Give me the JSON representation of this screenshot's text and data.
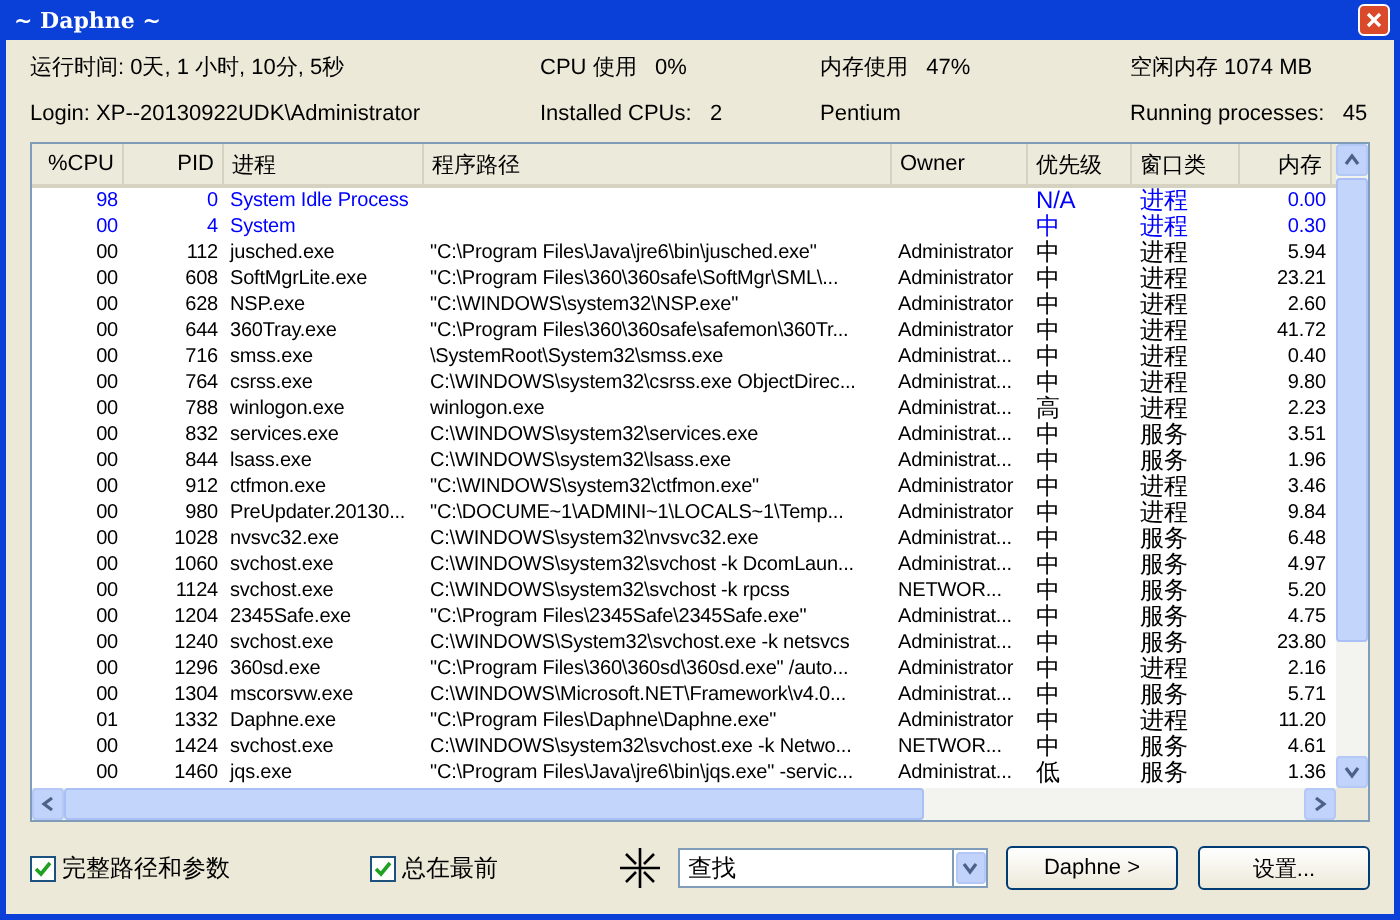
{
  "window": {
    "title": "~ Daphne ~"
  },
  "info": [
    {
      "label": "运行时间: 0天, 1 小时, 10分, 5秒"
    },
    {
      "label": "CPU 使用",
      "value": "0%"
    },
    {
      "label": "内存使用",
      "value": "47%"
    },
    {
      "label": "空闲内存 1074 MB"
    },
    {
      "label": "Login: XP--20130922UDK\\Administrator"
    },
    {
      "label": "Installed CPUs:",
      "value": "2"
    },
    {
      "label": "Pentium"
    },
    {
      "label": "Running processes:",
      "value": "45"
    }
  ],
  "table": {
    "columns": [
      "%CPU",
      "PID",
      "进程",
      "程序路径",
      "Owner",
      "优先级",
      "窗口类",
      "内存"
    ],
    "rows": [
      {
        "kind": "system",
        "cells": [
          "98",
          "0",
          "System Idle Process",
          "",
          "",
          "N/A",
          "进程",
          "0.00"
        ]
      },
      {
        "kind": "system",
        "cells": [
          "00",
          "4",
          "System",
          "",
          "",
          "中",
          "进程",
          "0.30"
        ]
      },
      {
        "kind": "normal",
        "cells": [
          "00",
          "112",
          "jusched.exe",
          "\"C:\\Program Files\\Java\\jre6\\bin\\jusched.exe\"",
          "Administrator",
          "中",
          "进程",
          "5.94"
        ]
      },
      {
        "kind": "normal",
        "cells": [
          "00",
          "608",
          "SoftMgrLite.exe",
          "\"C:\\Program Files\\360\\360safe\\SoftMgr\\SML\\...",
          "Administrator",
          "中",
          "进程",
          "23.21"
        ]
      },
      {
        "kind": "normal",
        "cells": [
          "00",
          "628",
          "NSP.exe",
          "\"C:\\WINDOWS\\system32\\NSP.exe\"",
          "Administrator",
          "中",
          "进程",
          "2.60"
        ]
      },
      {
        "kind": "normal",
        "cells": [
          "00",
          "644",
          "360Tray.exe",
          "\"C:\\Program Files\\360\\360safe\\safemon\\360Tr...",
          "Administrator",
          "中",
          "进程",
          "41.72"
        ]
      },
      {
        "kind": "normal",
        "cells": [
          "00",
          "716",
          "smss.exe",
          "\\SystemRoot\\System32\\smss.exe",
          "Administrat...",
          "中",
          "进程",
          "0.40"
        ]
      },
      {
        "kind": "normal",
        "cells": [
          "00",
          "764",
          "csrss.exe",
          "C:\\WINDOWS\\system32\\csrss.exe ObjectDirec...",
          "Administrat...",
          "中",
          "进程",
          "9.80"
        ]
      },
      {
        "kind": "normal",
        "cells": [
          "00",
          "788",
          "winlogon.exe",
          "winlogon.exe",
          "Administrat...",
          "高",
          "进程",
          "2.23"
        ]
      },
      {
        "kind": "normal",
        "cells": [
          "00",
          "832",
          "services.exe",
          "C:\\WINDOWS\\system32\\services.exe",
          "Administrat...",
          "中",
          "服务",
          "3.51"
        ]
      },
      {
        "kind": "normal",
        "cells": [
          "00",
          "844",
          "lsass.exe",
          "C:\\WINDOWS\\system32\\lsass.exe",
          "Administrat...",
          "中",
          "服务",
          "1.96"
        ]
      },
      {
        "kind": "normal",
        "cells": [
          "00",
          "912",
          "ctfmon.exe",
          "\"C:\\WINDOWS\\system32\\ctfmon.exe\"",
          "Administrator",
          "中",
          "进程",
          "3.46"
        ]
      },
      {
        "kind": "normal",
        "cells": [
          "00",
          "980",
          "PreUpdater.20130...",
          "\"C:\\DOCUME~1\\ADMINI~1\\LOCALS~1\\Temp...",
          "Administrator",
          "中",
          "进程",
          "9.84"
        ]
      },
      {
        "kind": "normal",
        "cells": [
          "00",
          "1028",
          "nvsvc32.exe",
          "C:\\WINDOWS\\system32\\nvsvc32.exe",
          "Administrat...",
          "中",
          "服务",
          "6.48"
        ]
      },
      {
        "kind": "normal",
        "cells": [
          "00",
          "1060",
          "svchost.exe",
          "C:\\WINDOWS\\system32\\svchost -k DcomLaun...",
          "Administrat...",
          "中",
          "服务",
          "4.97"
        ]
      },
      {
        "kind": "normal",
        "cells": [
          "00",
          "1124",
          "svchost.exe",
          "C:\\WINDOWS\\system32\\svchost -k rpcss",
          "NETWOR...",
          "中",
          "服务",
          "5.20"
        ]
      },
      {
        "kind": "normal",
        "cells": [
          "00",
          "1204",
          "2345Safe.exe",
          "\"C:\\Program Files\\2345Safe\\2345Safe.exe\"",
          "Administrat...",
          "中",
          "服务",
          "4.75"
        ]
      },
      {
        "kind": "normal",
        "cells": [
          "00",
          "1240",
          "svchost.exe",
          "C:\\WINDOWS\\System32\\svchost.exe -k netsvcs",
          "Administrat...",
          "中",
          "服务",
          "23.80"
        ]
      },
      {
        "kind": "normal",
        "cells": [
          "00",
          "1296",
          "360sd.exe",
          "\"C:\\Program Files\\360\\360sd\\360sd.exe\" /auto...",
          "Administrator",
          "中",
          "进程",
          "2.16"
        ]
      },
      {
        "kind": "normal",
        "cells": [
          "00",
          "1304",
          "mscorsvw.exe",
          "C:\\WINDOWS\\Microsoft.NET\\Framework\\v4.0...",
          "Administrat...",
          "中",
          "服务",
          "5.71"
        ]
      },
      {
        "kind": "normal",
        "cells": [
          "01",
          "1332",
          "Daphne.exe",
          "\"C:\\Program Files\\Daphne\\Daphne.exe\"",
          "Administrator",
          "中",
          "进程",
          "11.20"
        ]
      },
      {
        "kind": "normal",
        "cells": [
          "00",
          "1424",
          "svchost.exe",
          "C:\\WINDOWS\\system32\\svchost.exe -k Netwo...",
          "NETWOR...",
          "中",
          "服务",
          "4.61"
        ]
      },
      {
        "kind": "normal",
        "cells": [
          "00",
          "1460",
          "jqs.exe",
          "\"C:\\Program Files\\Java\\jre6\\bin\\jqs.exe\" -servic...",
          "Administrat...",
          "低",
          "服务",
          "1.36"
        ]
      }
    ]
  },
  "options": [
    {
      "label": "完整路径和参数",
      "checked": true
    },
    {
      "label": "总在最前",
      "checked": true
    }
  ],
  "search": {
    "value": "查找"
  },
  "buttons": [
    "Daphne >",
    "设置..."
  ]
}
